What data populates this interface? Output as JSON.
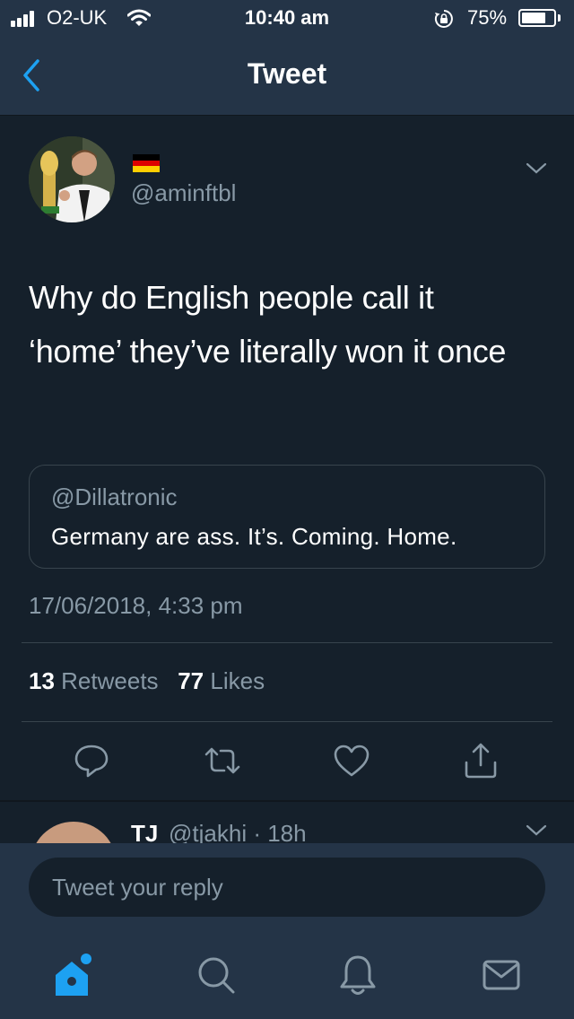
{
  "status_bar": {
    "carrier": "O2-UK",
    "time": "10:40 am",
    "battery_percent": "75%",
    "battery_level": 0.75,
    "icons": [
      "signal-bars-icon",
      "wifi-icon",
      "rotation-lock-icon",
      "battery-icon"
    ]
  },
  "nav": {
    "title": "Tweet",
    "back_icon": "chevron-left-icon"
  },
  "tweet": {
    "flag_emoji": "germany-flag",
    "handle": "@aminftbl",
    "text": "Why do English people call it ‘home’ they’ve literally won it once",
    "quote": {
      "handle": "@Dillatronic",
      "text": "Germany are ass. It’s. Coming. Home."
    },
    "timestamp": "17/06/2018, 4:33 pm",
    "retweets_count": "13",
    "retweets_label": "Retweets",
    "likes_count": "77",
    "likes_label": "Likes",
    "actions": [
      "reply-icon",
      "retweet-icon",
      "like-icon",
      "share-icon"
    ]
  },
  "reply_preview": {
    "name": "TJ",
    "handle_time": "@tjakhi · 18h"
  },
  "reply_box": {
    "placeholder": "Tweet your reply"
  },
  "tab_bar": {
    "items": [
      "home-icon",
      "search-icon",
      "notifications-icon",
      "messages-icon"
    ],
    "home_has_notification": true
  },
  "colors": {
    "background": "#15202b",
    "bar": "#243447",
    "accent": "#1da1f2",
    "secondary_text": "#8899a6",
    "flag": [
      "#000000",
      "#dd0000",
      "#ffce00"
    ]
  }
}
